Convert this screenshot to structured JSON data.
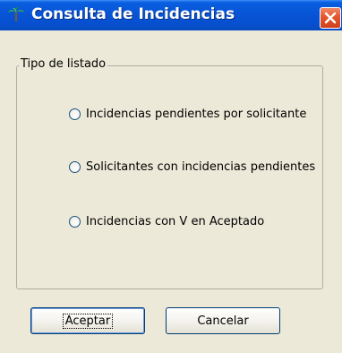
{
  "window": {
    "title": "Consulta de Incidencias",
    "icon": "palm-tree-icon",
    "close_icon": "close-icon",
    "close_color": "#e2572d",
    "titlebar_color": "#0754d6"
  },
  "group": {
    "legend": "Tipo de listado",
    "options": [
      {
        "label": "Incidencias pendientes por solicitante",
        "selected": false
      },
      {
        "label": "Solicitantes con incidencias pendientes",
        "selected": false
      },
      {
        "label": "Incidencias con V en Aceptado",
        "selected": false
      }
    ]
  },
  "buttons": {
    "accept_label": "Aceptar",
    "cancel_label": "Cancelar"
  }
}
